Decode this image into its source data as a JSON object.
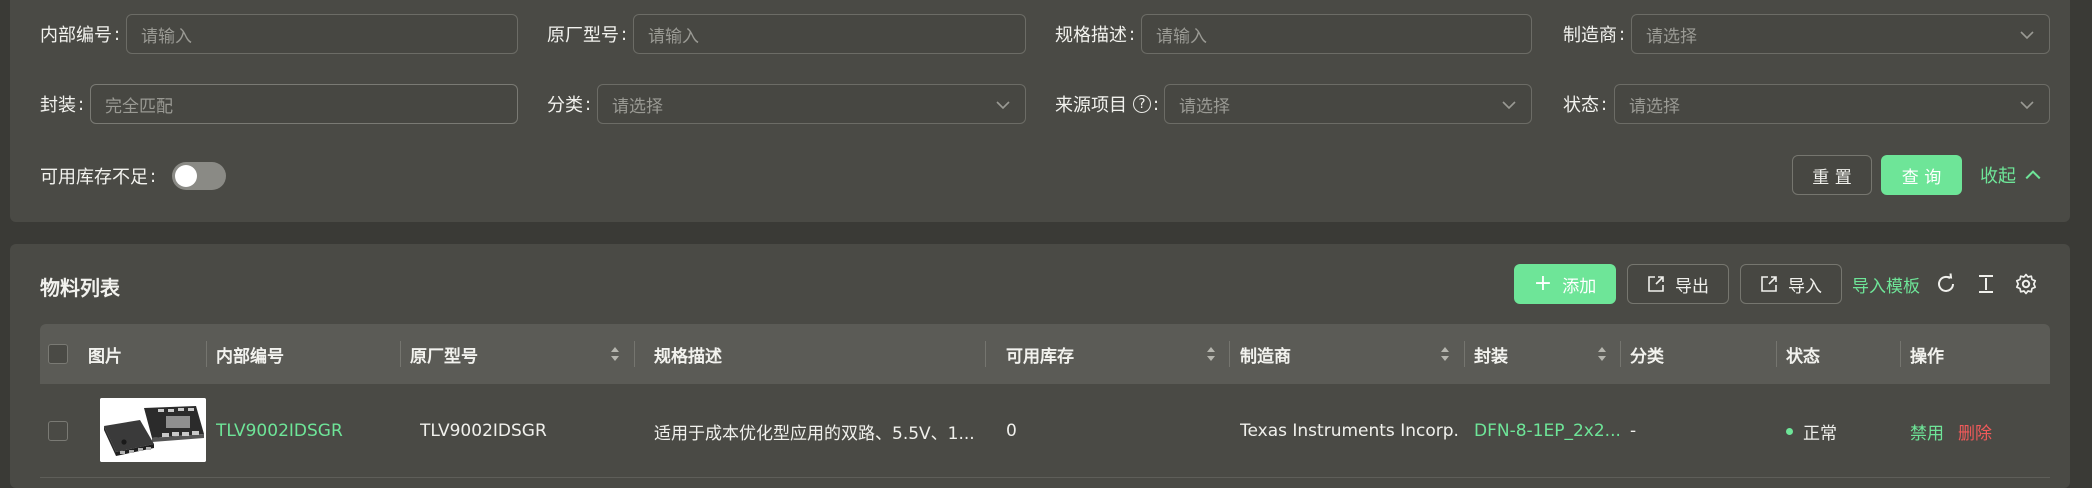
{
  "search": {
    "fields": {
      "internal_no": {
        "label": "内部编号",
        "placeholder": "请输入"
      },
      "mfr_model": {
        "label": "原厂型号",
        "placeholder": "请输入"
      },
      "spec_desc": {
        "label": "规格描述",
        "placeholder": "请输入"
      },
      "manufacturer": {
        "label": "制造商",
        "placeholder": "请选择"
      },
      "package": {
        "label": "封装",
        "placeholder": "完全匹配"
      },
      "category": {
        "label": "分类",
        "placeholder": "请选择"
      },
      "source_project": {
        "label": "来源项目",
        "placeholder": "请选择"
      },
      "status": {
        "label": "状态",
        "placeholder": "请选择"
      }
    },
    "low_stock_label": "可用库存不足",
    "low_stock_enabled": false,
    "reset_label": "重 置",
    "query_label": "查 询",
    "collapse_label": "收起",
    "help_glyph": "?"
  },
  "list": {
    "title": "物料列表",
    "add_label": "添加",
    "add_glyph": "+",
    "export_label": "导出",
    "import_label": "导入",
    "import_template_label": "导入模板",
    "columns": [
      "图片",
      "内部编号",
      "原厂型号",
      "规格描述",
      "可用库存",
      "制造商",
      "封装",
      "分类",
      "状态",
      "操作"
    ],
    "rows": [
      {
        "internal_no": "TLV9002IDSGR",
        "mfr_model": "TLV9002IDSGR",
        "spec_desc": "适用于成本优化型应用的双路、5.5V、1...",
        "available_stock": "0",
        "manufacturer": "Texas Instruments Incorp...",
        "package": "DFN-8-1EP_2x2...",
        "category": "-",
        "status": "正常",
        "action_disable": "禁用",
        "action_delete": "删除"
      }
    ]
  },
  "colors": {
    "accent": "#6ee598",
    "danger": "#f05a5a",
    "panel": "#4a4a45",
    "background": "#3a3a36"
  },
  "icons": [
    "chevron-down-icon",
    "question-circle-icon",
    "chevron-up-icon",
    "plus-icon",
    "export-icon",
    "import-icon",
    "refresh-icon",
    "column-height-icon",
    "settings-icon",
    "sort-icon"
  ]
}
